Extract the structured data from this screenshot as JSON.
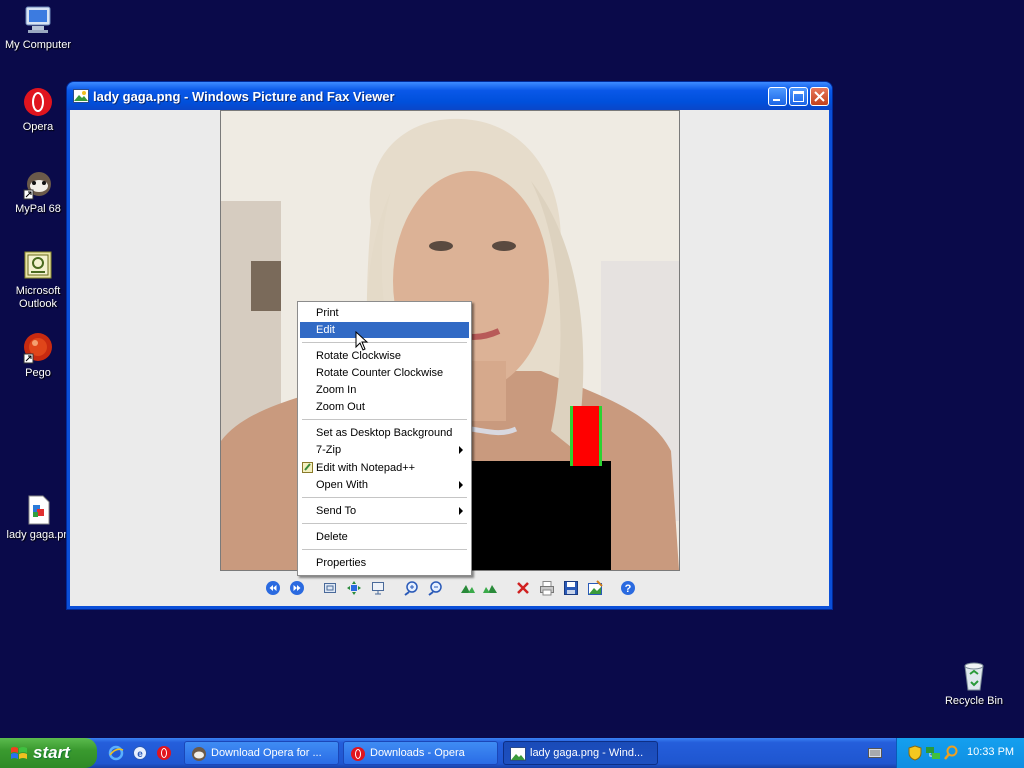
{
  "desktop": {
    "icons": [
      {
        "label": "My Computer",
        "icon": "my-computer-icon"
      },
      {
        "label": "Opera",
        "icon": "opera-icon"
      },
      {
        "label": "MyPal 68",
        "icon": "mypal-icon"
      },
      {
        "label": "Microsoft Outlook",
        "icon": "outlook-icon"
      },
      {
        "label": "Pego",
        "icon": "pego-icon"
      },
      {
        "label": "lady gaga.pn",
        "icon": "png-file-icon"
      },
      {
        "label": "Recycle Bin",
        "icon": "recycle-bin-icon"
      }
    ]
  },
  "window": {
    "title": "lady gaga.png - Windows Picture and Fax Viewer",
    "controls": [
      "minimize",
      "maximize",
      "close"
    ]
  },
  "toolbar": {
    "buttons": [
      "previous-image",
      "next-image",
      "best-fit",
      "actual-size",
      "slideshow",
      "zoom-in",
      "zoom-out",
      "rotate-clockwise",
      "rotate-counterclockwise",
      "delete",
      "print",
      "copy-to",
      "open-for-editing",
      "help"
    ]
  },
  "context_menu": {
    "items": {
      "print": "Print",
      "edit": "Edit",
      "rotate_cw": "Rotate Clockwise",
      "rotate_ccw": "Rotate Counter Clockwise",
      "zoom_in": "Zoom In",
      "zoom_out": "Zoom Out",
      "set_bg": "Set as Desktop Background",
      "zip": "7-Zip",
      "notepad": "Edit with Notepad++",
      "open_with": "Open With",
      "send_to": "Send To",
      "delete": "Delete",
      "properties": "Properties"
    },
    "highlighted": "Edit"
  },
  "taskbar": {
    "start": "start",
    "tasks": [
      {
        "label": "Download Opera for ...",
        "active": false
      },
      {
        "label": "Downloads - Opera",
        "active": false
      },
      {
        "label": "lady gaga.png - Wind...",
        "active": true
      }
    ],
    "clock": "10:33 PM"
  },
  "colors": {
    "desktop": "#0a0a4a",
    "title_bar": "#0a58e8",
    "menu_highlight": "#316ac5",
    "start_button": "#3a9a2f"
  }
}
